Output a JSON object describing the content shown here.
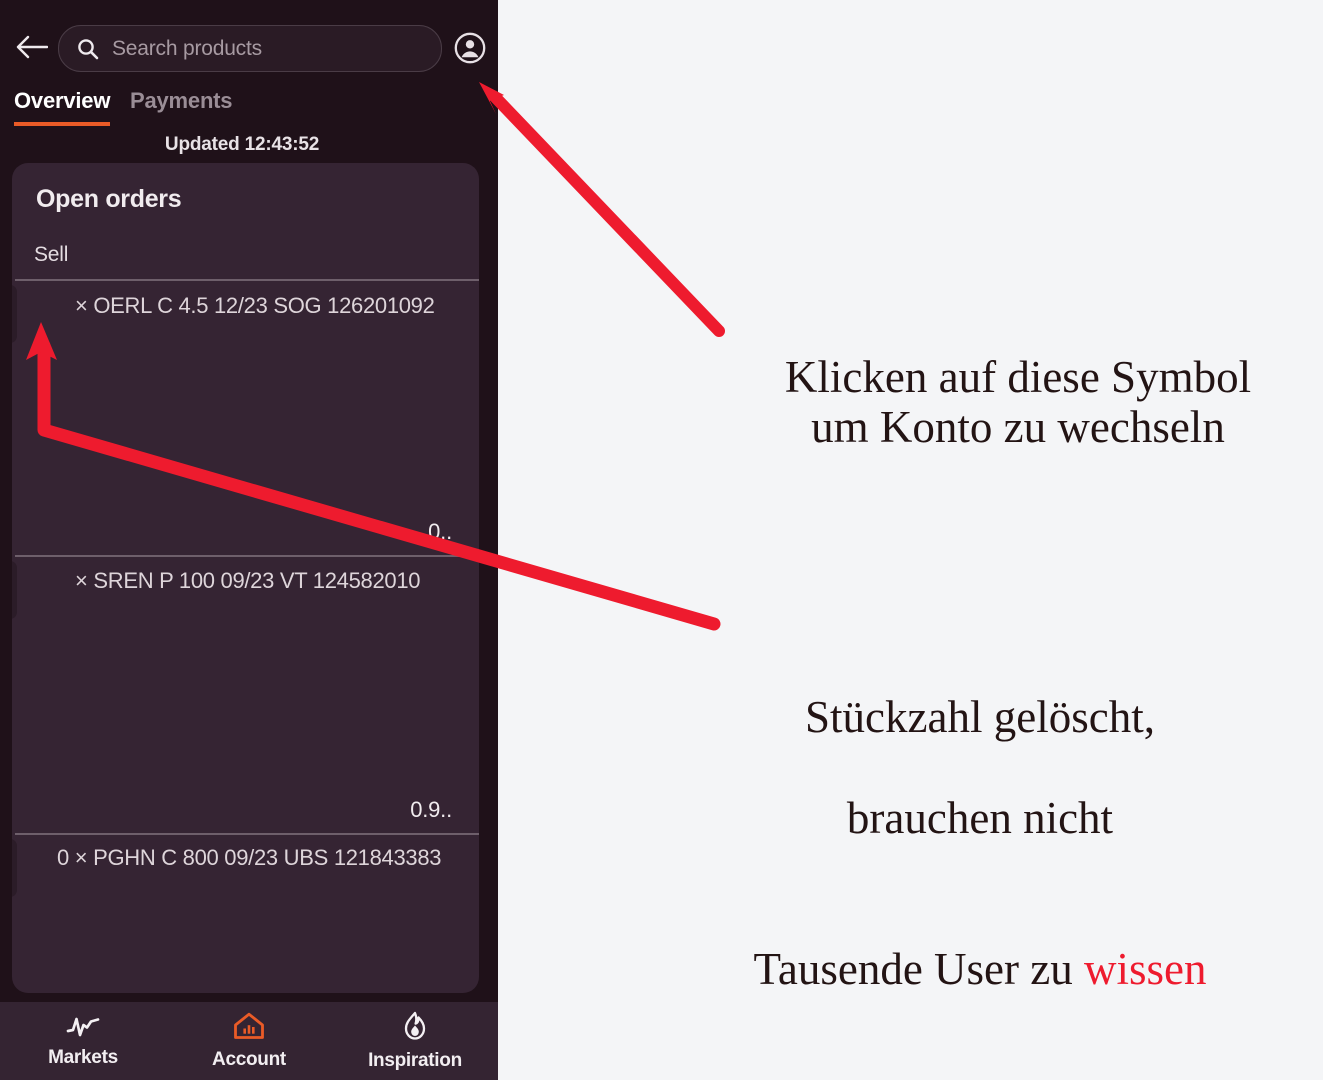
{
  "app": {
    "topbar": {
      "back_icon": "back-arrow-icon",
      "search": {
        "icon": "search-icon",
        "placeholder": "Search products",
        "value": ""
      },
      "profile_icon": "account-circle-icon"
    },
    "tabs": [
      {
        "label": "Overview",
        "active": true
      },
      {
        "label": "Payments",
        "active": false
      }
    ],
    "status": {
      "updated": "Updated 12:43:52"
    },
    "card": {
      "title": "Open orders",
      "side_label": "Sell",
      "rows": [
        {
          "label": "× OERL C 4.5 12/23 SOG 126201092",
          "value": "0.."
        },
        {
          "label": "× SREN P 100 09/23 VT 124582010",
          "value": "0.9.."
        },
        {
          "label": "0 × PGHN C 800 09/23 UBS 121843383",
          "value": ""
        }
      ]
    },
    "bottom_nav": [
      {
        "label": "Markets",
        "icon": "chart-line-icon",
        "active": false
      },
      {
        "label": "Account",
        "icon": "house-chart-icon",
        "active": true
      },
      {
        "label": "Inspiration",
        "icon": "flame-icon",
        "active": false
      }
    ]
  },
  "annotations": {
    "note_1": "Klicken auf diese Symbol\num Konto zu wechseln",
    "note_2_line1": "Stückzahl gelöscht,",
    "note_2_line2": "brauchen nicht",
    "note_2_line3_a": "Tausende User zu ",
    "note_2_line3_b": "wissen"
  },
  "colors": {
    "panel_bg": "#1f1119",
    "card_bg": "#352433",
    "nav_bg": "#342432",
    "accent": "#ea5b27",
    "annotation_red": "#ee1b2e",
    "page_bg": "#f4f5f7"
  }
}
